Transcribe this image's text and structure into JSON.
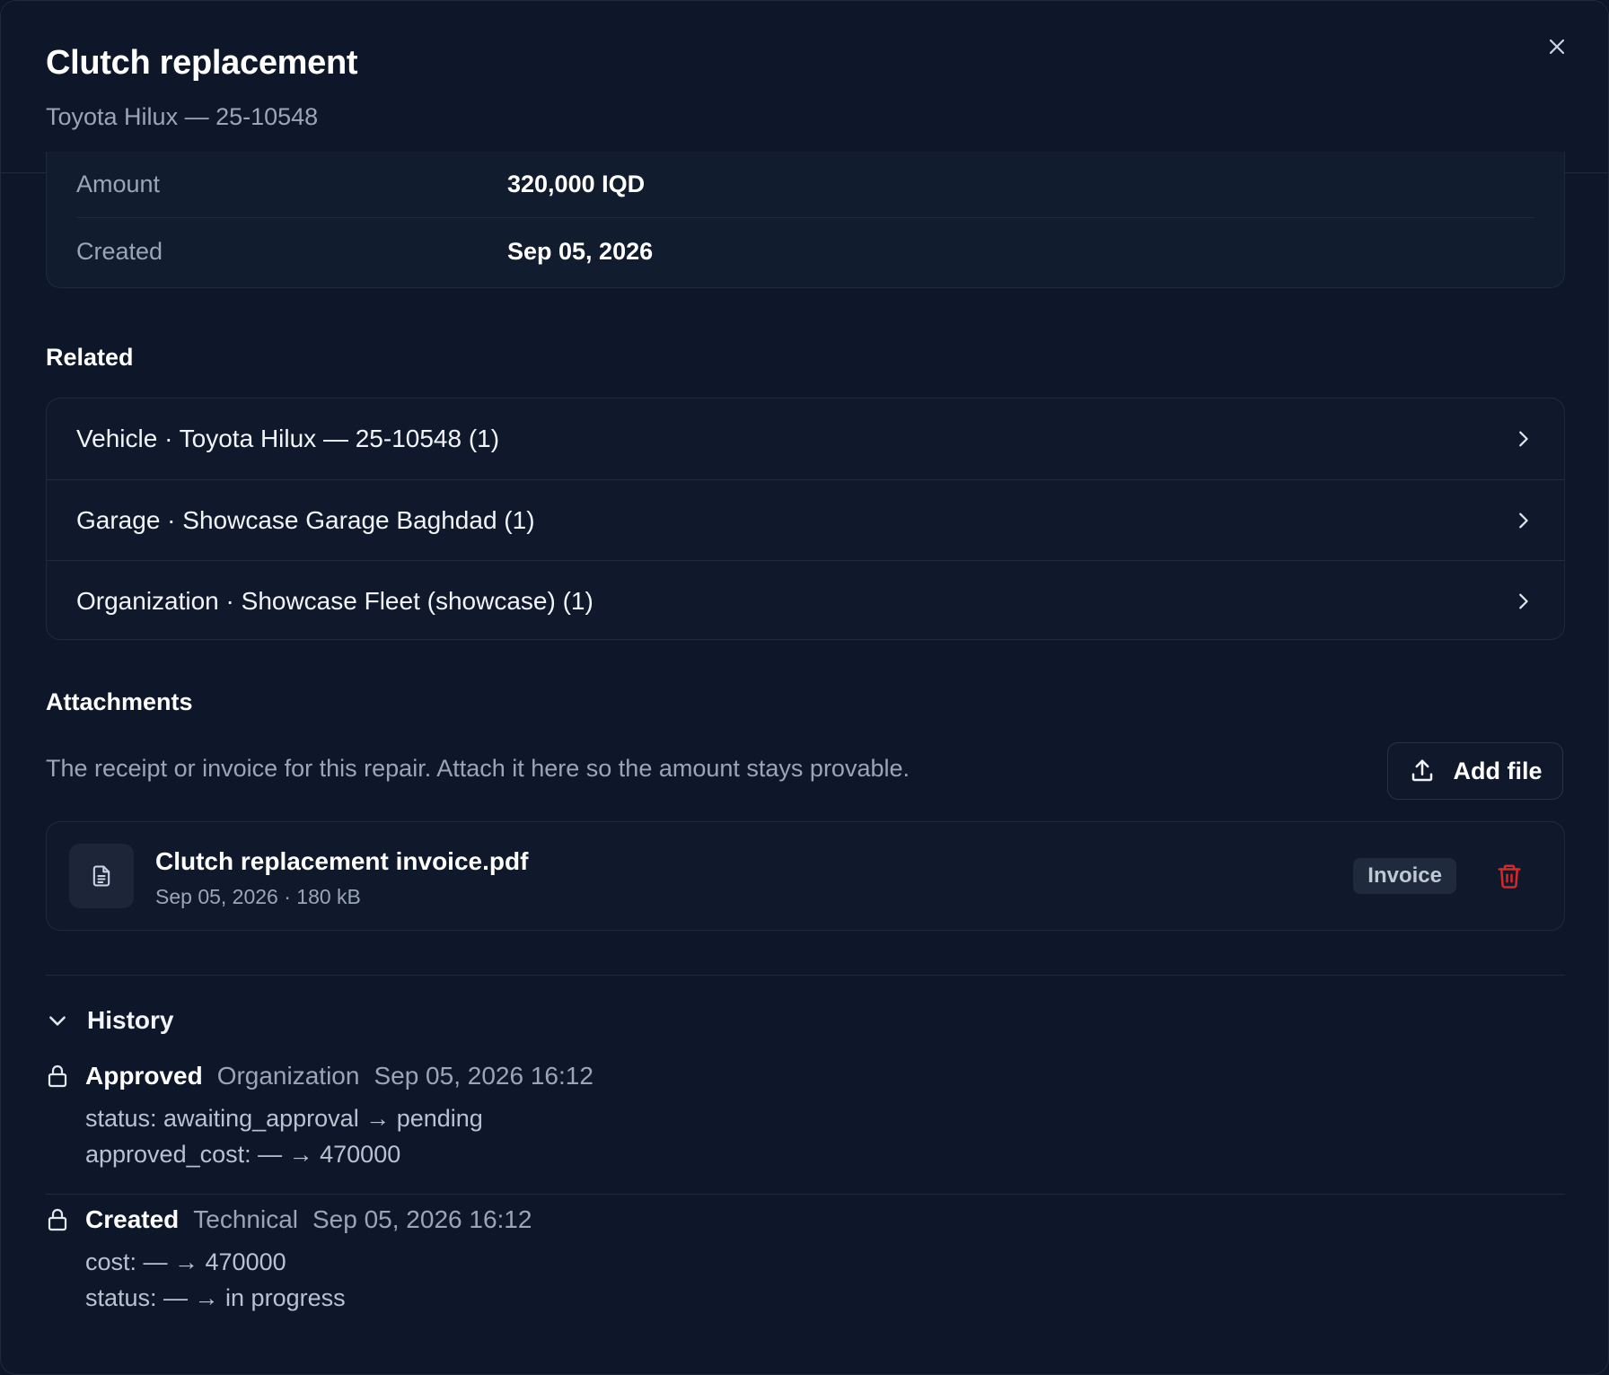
{
  "header": {
    "title": "Clutch replacement",
    "subtitle": "Toyota Hilux — 25-10548"
  },
  "details": [
    {
      "label": "Amount",
      "value": "320,000 IQD"
    },
    {
      "label": "Created",
      "value": "Sep 05, 2026"
    }
  ],
  "related": {
    "title": "Related",
    "items": [
      {
        "label": "Vehicle · Toyota Hilux — 25-10548 (1)"
      },
      {
        "label": "Garage · Showcase Garage Baghdad (1)"
      },
      {
        "label": "Organization · Showcase Fleet (showcase) (1)"
      }
    ]
  },
  "attachments": {
    "title": "Attachments",
    "description": "The receipt or invoice for this repair. Attach it here so the amount stays provable.",
    "add_label": "Add file",
    "files": [
      {
        "name": "Clutch replacement invoice.pdf",
        "meta": "Sep 05, 2026 · 180 kB",
        "badge": "Invoice"
      }
    ]
  },
  "history": {
    "label": "History",
    "entries": [
      {
        "action": "Approved",
        "role": "Organization",
        "time": "Sep 05, 2026 16:12",
        "changes": [
          "status: awaiting_approval → pending",
          "approved_cost: — → 470000"
        ]
      },
      {
        "action": "Created",
        "role": "Technical",
        "time": "Sep 05, 2026 16:12",
        "changes": [
          "cost: — → 470000",
          "status: — → in progress"
        ]
      }
    ]
  },
  "colors": {
    "background": "#0e1729",
    "danger": "#dc2626",
    "muted_text": "#9aa5b8"
  }
}
